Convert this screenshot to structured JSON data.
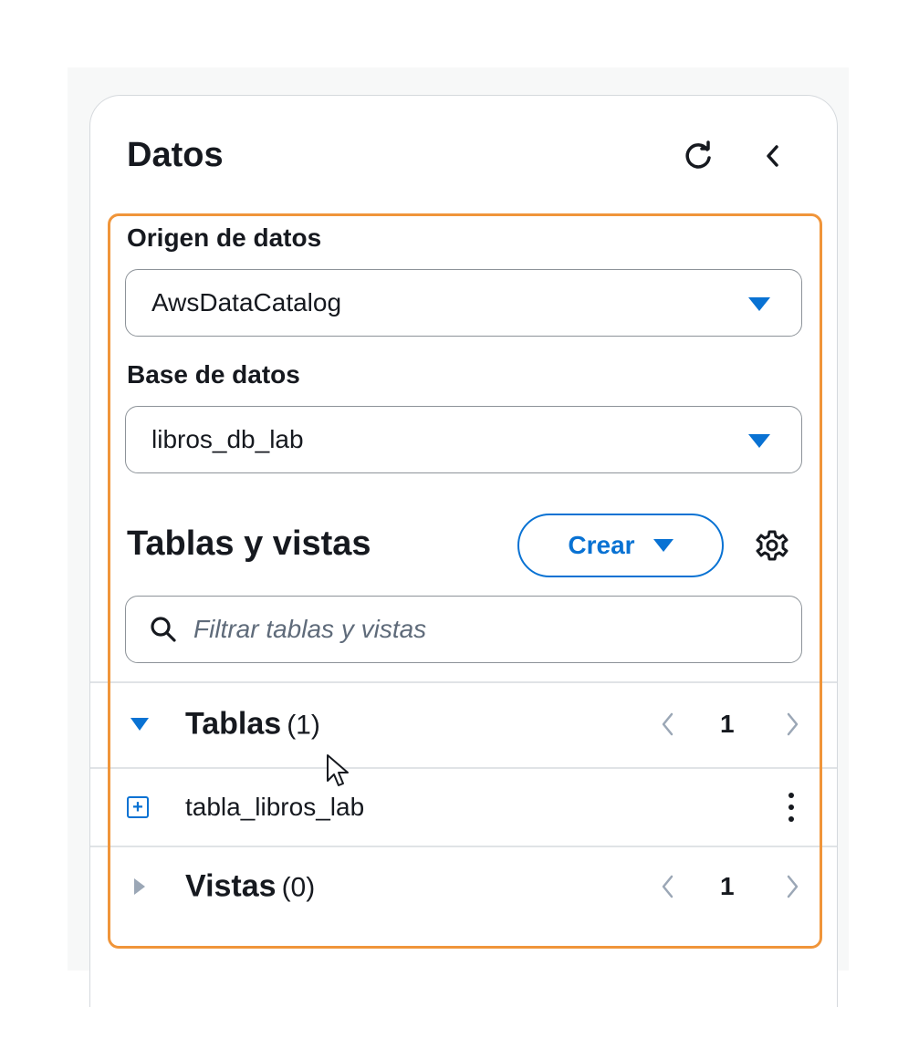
{
  "panel": {
    "title": "Datos",
    "refresh_icon": "refresh-icon",
    "collapse_icon": "chevron-left-icon"
  },
  "data_source": {
    "label": "Origen de datos",
    "value": "AwsDataCatalog"
  },
  "database": {
    "label": "Base de datos",
    "value": "libros_db_lab"
  },
  "tables_section": {
    "title": "Tablas y vistas",
    "create_label": "Crear",
    "settings_icon": "gear-icon",
    "filter_placeholder": "Filtrar tablas y vistas"
  },
  "groups": {
    "tables": {
      "label": "Tablas",
      "count": "(1)",
      "page": "1",
      "expanded": true,
      "items": [
        {
          "name": "tabla_libros_lab"
        }
      ]
    },
    "views": {
      "label": "Vistas",
      "count": "(0)",
      "page": "1",
      "expanded": false
    }
  },
  "colors": {
    "accent": "#0972d3",
    "highlight": "#f0953a",
    "text": "#16191f"
  }
}
